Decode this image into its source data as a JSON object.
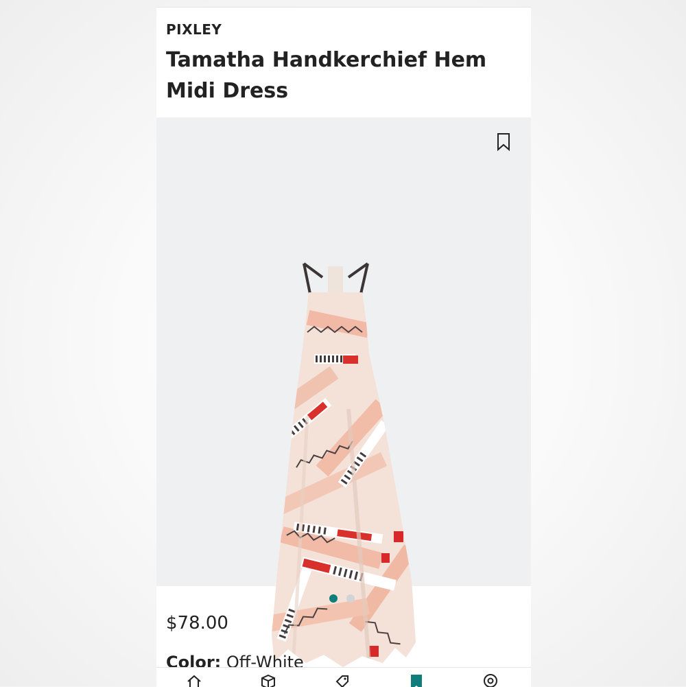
{
  "product": {
    "brand": "PIXLEY",
    "title": "Tamatha Handkerchief Hem Midi Dress",
    "price": "$78.00",
    "color_label": "Color:",
    "color_value": "Off-White"
  },
  "gallery": {
    "image_count": 2,
    "active_index": 0,
    "accent_color": "#0f7e7a"
  },
  "icons": {
    "bookmark": "bookmark-icon",
    "tabs": [
      "home-icon",
      "box-icon",
      "tag-icon",
      "bookmark-icon",
      "location-icon"
    ]
  },
  "tabbar": {
    "active_index": 3
  }
}
